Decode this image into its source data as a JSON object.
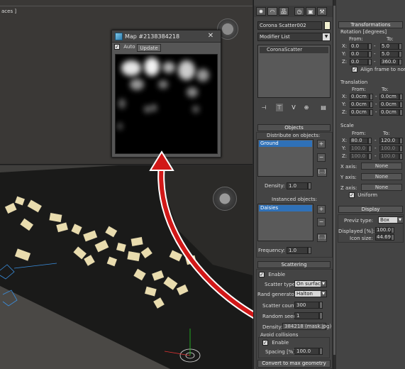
{
  "viewport_top": {
    "label": "aces ]"
  },
  "map_window": {
    "title": "Map #2138384218",
    "close_glyph": "✕",
    "auto_check": "✓",
    "auto_label": "Auto",
    "update_label": "Update"
  },
  "panel": {
    "tabs": [
      "✸",
      "◠",
      "品",
      "◷",
      "▣",
      "⚒"
    ],
    "object_name": "Corona Scatter002",
    "object_color": "#f1f0d0",
    "modifier_list": "Modifier List",
    "stack_item": "CoronaScatter",
    "stack_tools": [
      "⊣",
      "⊤",
      "V",
      "⊕",
      "▤"
    ],
    "objects": {
      "header": "Objects",
      "distribute_label": "Distribute on objects:",
      "distribute_items": [
        "Ground"
      ],
      "density_label": "Density:",
      "density_value": "1.0",
      "instanced_label": "Instanced objects:",
      "instanced_items": [
        "Daisies"
      ],
      "frequency_label": "Frequency:",
      "frequency_value": "1.0",
      "add_glyph": "+",
      "remove_glyph": "−",
      "more_glyph": "[...]"
    },
    "scattering": {
      "header": "Scattering",
      "enable_check": "✓",
      "enable_label": "Enable",
      "scatter_type_label": "Scatter type:",
      "scatter_type_value": "On surface",
      "rand_gen_label": "Rand generator:",
      "rand_gen_value": "Halton",
      "scatter_count_label": "Scatter count:",
      "scatter_count_value": "300",
      "random_seed_label": "Random seed:",
      "random_seed_value": "1",
      "density_label": "Density:",
      "density_value": "384218 (mask.jpg)",
      "avoid_label": "Avoid collisions",
      "avoid_check": "✓",
      "avoid_enable_label": "Enable",
      "spacing_label": "Spacing [%]:",
      "spacing_value": "100.0",
      "convert_label": "Convert to max geometry"
    }
  },
  "transformations": {
    "header": "Transformations",
    "rotation_label": "Rotation [degrees]",
    "from_label": "From:",
    "to_label": "To:",
    "rotation": [
      {
        "axis": "X:",
        "from": "0.0",
        "to": "5.0"
      },
      {
        "axis": "Y:",
        "from": "0.0",
        "to": "5.0"
      },
      {
        "axis": "Z:",
        "from": "0.0",
        "to": "360.0"
      }
    ],
    "dash": "-",
    "align_check": "✓",
    "align_label": "Align frame to normal",
    "translation_label": "Translation",
    "translation": [
      {
        "axis": "X:",
        "from": "0.0cm",
        "to": "0.0cm"
      },
      {
        "axis": "Y:",
        "from": "0.0cm",
        "to": "0.0cm"
      },
      {
        "axis": "Z:",
        "from": "0.0cm",
        "to": "0.0cm"
      }
    ],
    "scale_label": "Scale",
    "scale": [
      {
        "axis": "X:",
        "from": "80.0",
        "to": "120.0"
      },
      {
        "axis": "Y:",
        "from": "100.0",
        "to": "100.0"
      },
      {
        "axis": "Z:",
        "from": "100.0",
        "to": "100.0"
      }
    ],
    "axis_maps": [
      {
        "label": "X axis:",
        "value": "None"
      },
      {
        "label": "Y axis:",
        "value": "None"
      },
      {
        "label": "Z axis:",
        "value": "None"
      }
    ],
    "uniform_check": "✓",
    "uniform_label": "Uniform"
  },
  "display": {
    "header": "Display",
    "previz_label": "Previz type:",
    "previz_value": "Box",
    "displayed_label": "Displayed [%]:",
    "displayed_value": "100.0",
    "icon_size_label": "Icon size:",
    "icon_size_value": "44.69"
  },
  "colors": {
    "arrow": "#d11818",
    "selection": "#2f71b8",
    "box_face": "#e9dcae"
  }
}
